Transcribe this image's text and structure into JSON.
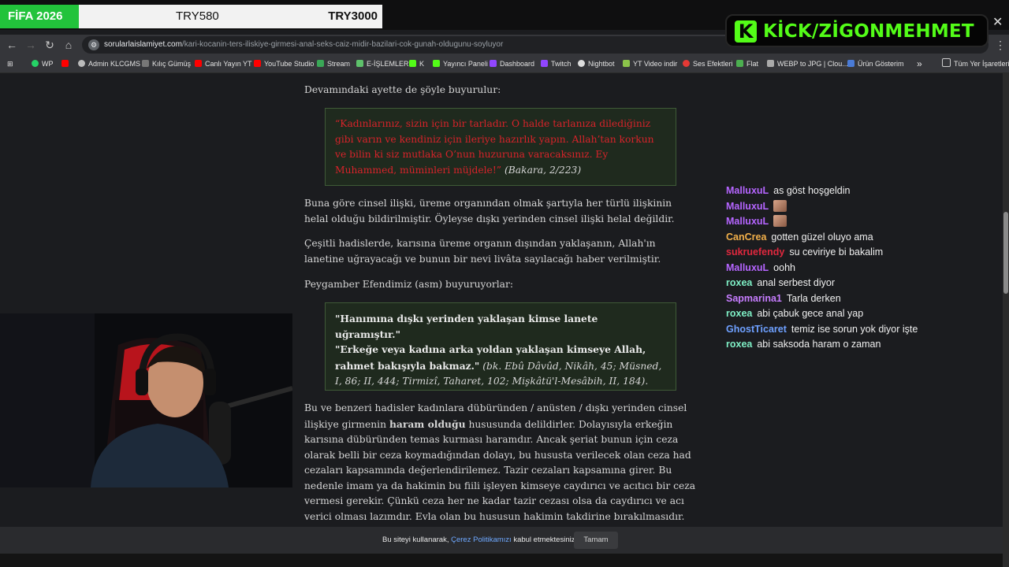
{
  "banner": {
    "game": "FİFA 2026",
    "amount_left": "TRY580",
    "amount_right": "TRY3000"
  },
  "kick": {
    "logo_letter": "K",
    "channel": "KİCK/ZİGONMEHMET",
    "close": "✕"
  },
  "browser": {
    "url_domain": "sorularlaislamiyet.com",
    "url_path": "/kari-kocanin-ters-iliskiye-girmesi-anal-seks-caiz-midir-bazilari-cok-gunah-oldugunu-soyluyor",
    "bookmarks": [
      "WP",
      "Admin KLCGMS",
      "Kılıç Gümüş",
      "Canlı Yayın YT",
      "YouTube Studio",
      "Stream",
      "E-İŞLEMLER",
      "K",
      "Yayıncı Paneli",
      "Dashboard",
      "Twitch",
      "Nightbot",
      "YT Video indir",
      "Ses Efektleri",
      "Flat",
      "WEBP to JPG | Clou...",
      "Ürün Gösterim"
    ],
    "bookmarks_overflow": "»",
    "all_bookmarks": "Tüm Yer İşaretleri"
  },
  "article": {
    "p1": "Devamındaki ayette de şöyle buyurulur:",
    "quote1_text": "“Kadınlarınız, sizin için bir tarladır. O halde tarlanıza dilediğiniz gibi varın ve kendiniz için ileriye hazırlık yapın. Allah’tan korkun ve bilin ki siz mutlaka O’nun huzuruna varacaksınız. Ey Muhammed, müminleri müjdele!”",
    "quote1_ref": " (Bakara, 2/223)",
    "p2": "Buna göre cinsel ilişki, üreme organından olmak şartıyla her türlü ilişkinin helal olduğu bildirilmiştir. Öyleyse dışkı yerinden cinsel ilişki helal değildir.",
    "p3": "Çeşitli hadislerde, karısına üreme organın dışından yaklaşanın, Allah'ın lanetine uğrayacağı ve bunun bir nevi livâta sayılacağı haber verilmiştir.",
    "p4": "Peygamber Efendimiz (asm) buyuruyorlar:",
    "quote2_line1": "\"Hanımına dışkı yerinden yaklaşan kimse lanete uğramıştır.\"",
    "quote2_line2": "\"Erkeğe veya kadına arka yoldan yaklaşan kimseye Allah, rahmet bakışıyla bakmaz.\"",
    "quote2_ref": " (bk. Ebû Dâvûd, Nikâh, 45; Müsned, I, 86; II, 444; Tirmizî, Taharet, 102; Mişkâtü'l-Mesâbih, II, 184).",
    "p5_a": "Bu ve benzeri hadisler kadınlara dübüründen / anüsten / dışkı yerinden cinsel ilişkiye girmenin ",
    "p5_bold": "haram olduğu",
    "p5_b": " hususunda delildirler. Dolayısıyla erkeğin karısına dübüründen temas kurması haramdır. Ancak şeriat bunun için ceza olarak belli bir ceza koymadığından dolayı, bu hususta verilecek olan ceza had cezaları kapsamında değerlendirilemez. Tazir cezaları kapsamına girer. Bu nedenle imam ya da hakimin bu fiili işleyen kimseye caydırıcı ve acıtıcı bir ceza vermesi gerekir. Çünkü ceza her ne kadar tazir cezası olsa da caydırıcı ve acı verici olması lazımdır. Evla olan bu hususun hakimin takdirine bırakılmasıdır."
  },
  "chat": [
    {
      "user": "MalluxuL",
      "color": "#b565ff",
      "text": "as göst hoşgeldin"
    },
    {
      "user": "MalluxuL",
      "color": "#b565ff",
      "text": "",
      "emote": "face-emote"
    },
    {
      "user": "MalluxuL",
      "color": "#b565ff",
      "text": "",
      "emote": "face-emote"
    },
    {
      "user": "CanCrea",
      "color": "#f2b04a",
      "text": "gotten güzel oluyo ama"
    },
    {
      "user": "sukruefendy",
      "color": "#e0283e",
      "text": "su ceviriye bi bakalim"
    },
    {
      "user": "MalluxuL",
      "color": "#b565ff",
      "text": "oohh"
    },
    {
      "user": "roxea",
      "color": "#7ff0c6",
      "text": "anal serbest diyor"
    },
    {
      "user": "Sapmarina1",
      "color": "#c77dff",
      "text": "Tarla derken"
    },
    {
      "user": "roxea",
      "color": "#7ff0c6",
      "text": "abi çabuk gece anal yap"
    },
    {
      "user": "GhostTicaret",
      "color": "#6ea0ff",
      "text": "temiz ise sorun yok diyor işte"
    },
    {
      "user": "roxea",
      "color": "#7ff0c6",
      "text": "abi saksoda haram o zaman"
    }
  ],
  "cookie": {
    "text_before": "Bu siteyi kullanarak, ",
    "link": "Çerez Politikamızı",
    "text_after": " kabul etmektesiniz.",
    "ok_button": "Tamam"
  }
}
